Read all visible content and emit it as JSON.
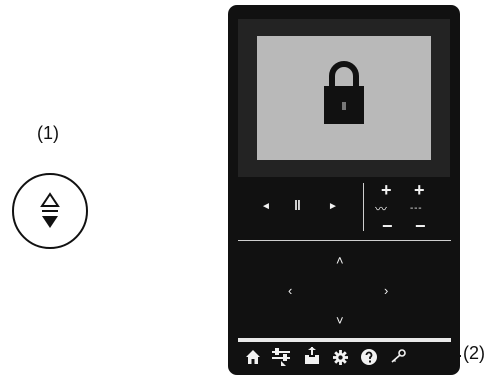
{
  "callouts": {
    "label_1": "(1)",
    "label_2": "(2)"
  },
  "controls": {
    "prev": "◄",
    "pause": "‖",
    "next": "►",
    "plus": "+",
    "minus": "−",
    "wave_ac": "〰",
    "wave_dc": "- - -",
    "up": "˄",
    "down": "˅",
    "left": "‹",
    "right": "›"
  },
  "icons": {
    "round_button": "up-down-arrows-icon",
    "screen": "lock-icon",
    "bottom_bar": [
      "home-icon",
      "settings-sliders-icon",
      "upload-icon",
      "gear-icon",
      "help-icon",
      "key-icon"
    ]
  },
  "colors": {
    "device": "#111111",
    "screen_bg": "#b9b9b9",
    "icon": "#f2f2f2"
  }
}
